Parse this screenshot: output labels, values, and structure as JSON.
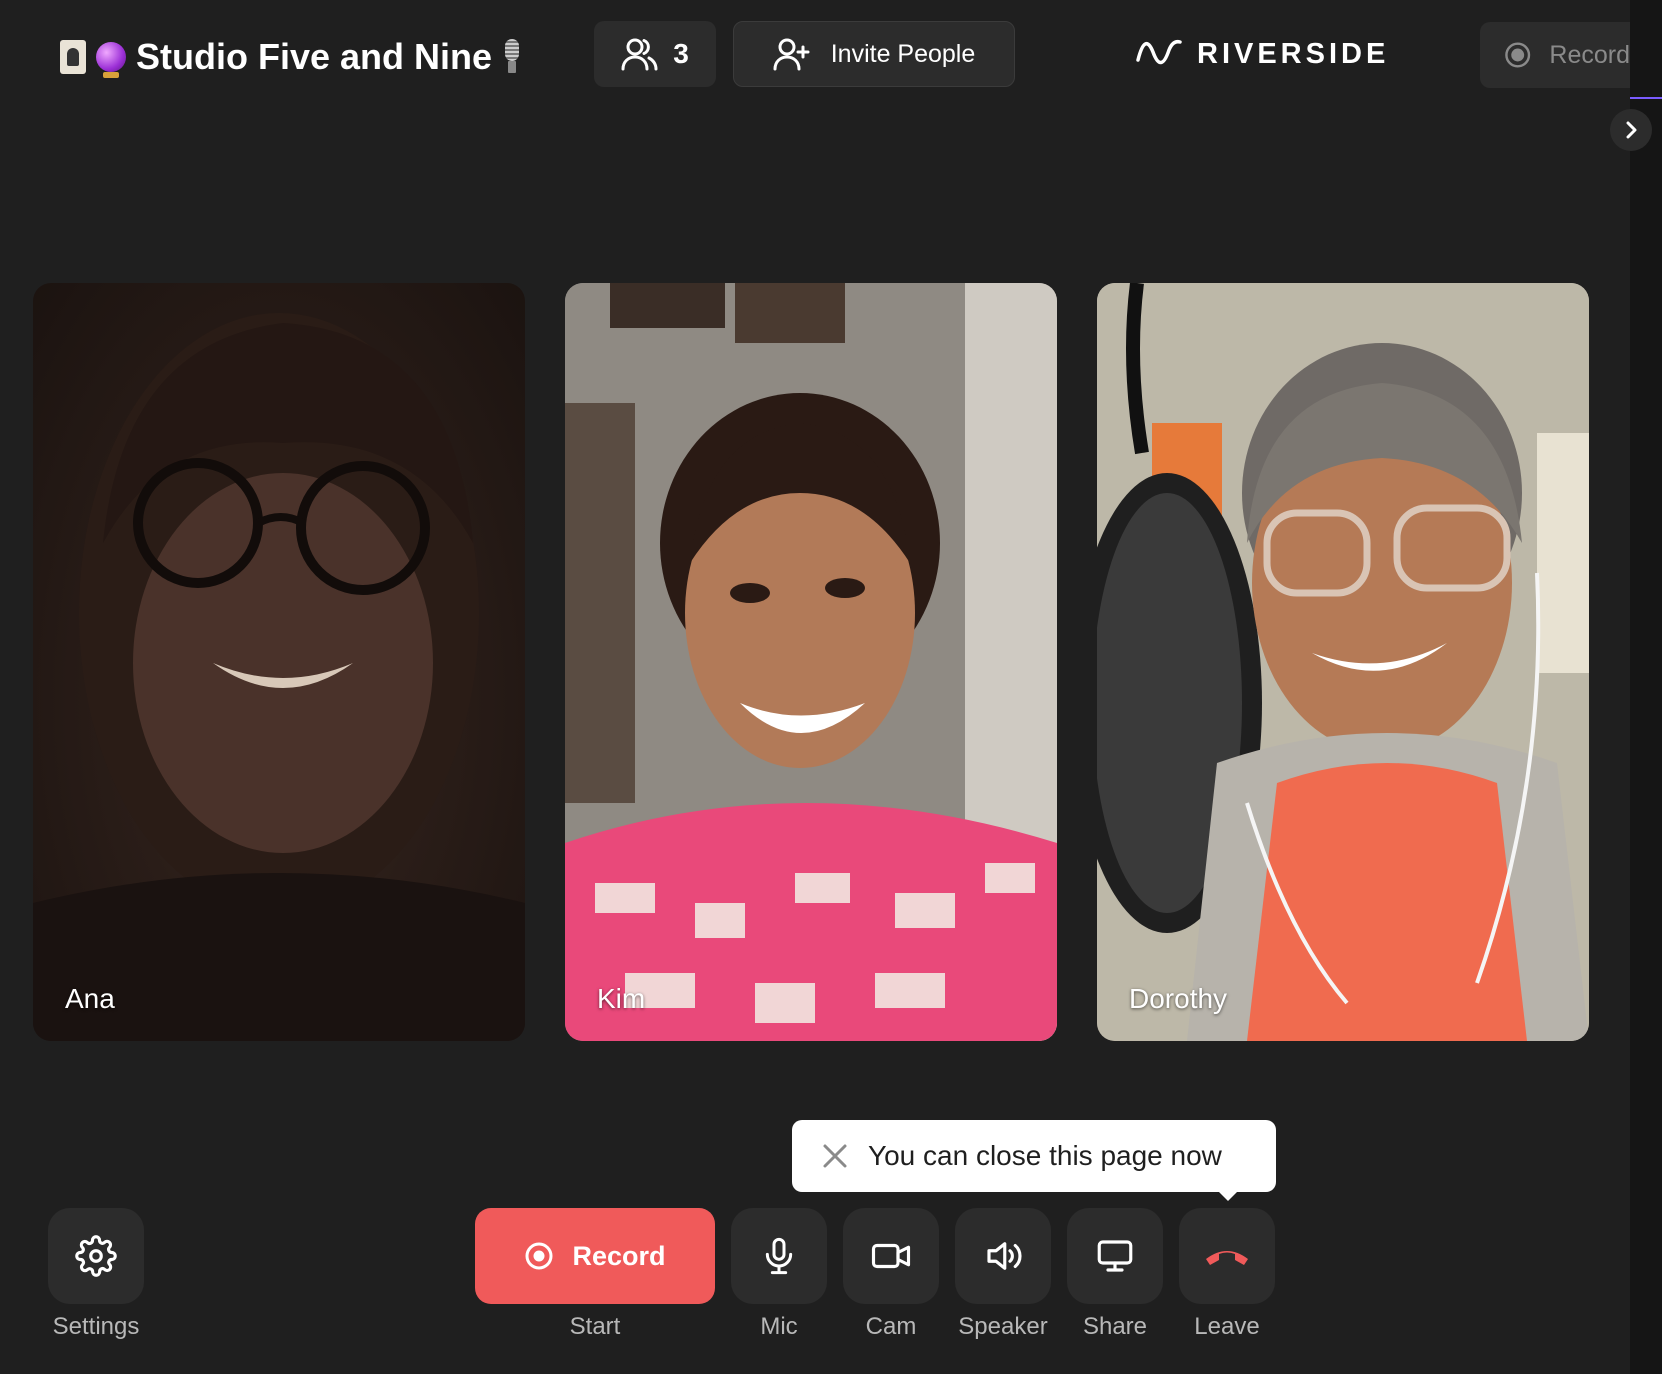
{
  "header": {
    "room_title": "Studio Five and Nine",
    "participant_count": "3",
    "invite_label": "Invite People",
    "brand": "RIVERSIDE",
    "record_label": "Record"
  },
  "participants": [
    {
      "name": "Ana"
    },
    {
      "name": "Kim"
    },
    {
      "name": "Dorothy"
    }
  ],
  "toast": {
    "message": "You can close this page now"
  },
  "controls": {
    "settings": "Settings",
    "record_button": "Record",
    "start": "Start",
    "mic": "Mic",
    "cam": "Cam",
    "speaker": "Speaker",
    "share": "Share",
    "leave": "Leave"
  },
  "colors": {
    "background": "#1f1f1f",
    "button_bg": "#2c2c2c",
    "record_red": "#f05a5a",
    "leave_red": "#f05a5a",
    "accent_line": "#7a5cff"
  }
}
